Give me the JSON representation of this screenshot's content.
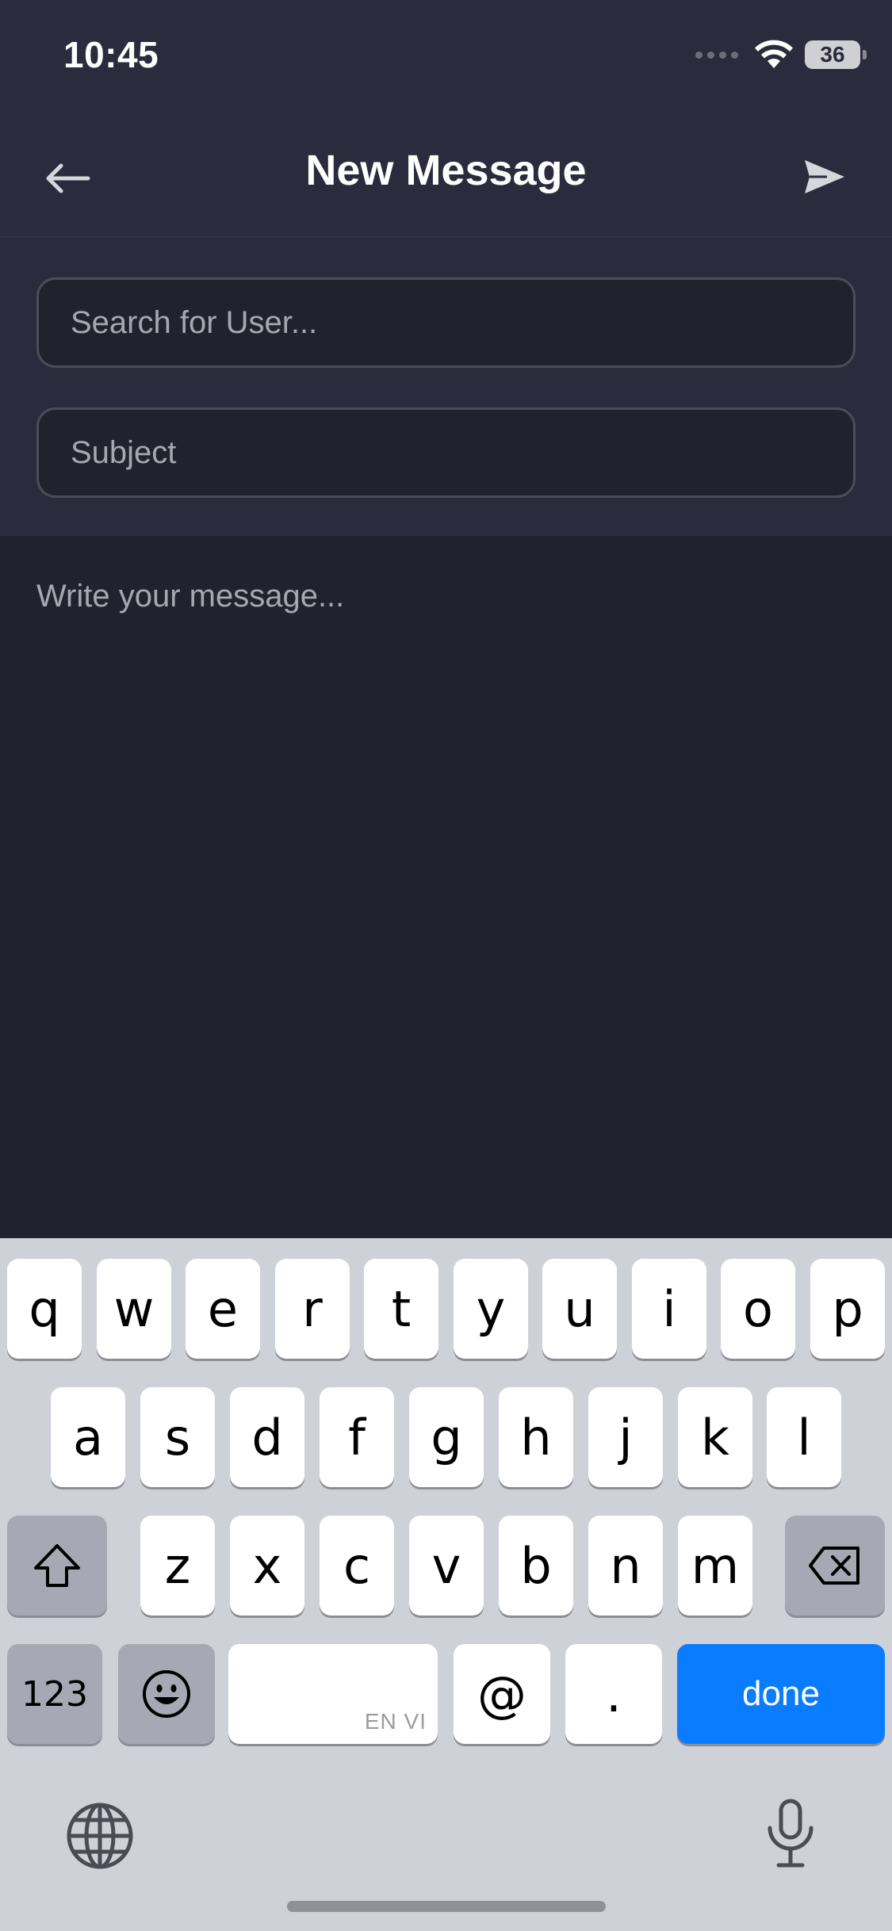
{
  "status_bar": {
    "time": "10:45",
    "battery_level": "36"
  },
  "nav": {
    "title": "New Message",
    "back_icon": "arrow-left-icon",
    "send_icon": "send-icon"
  },
  "form": {
    "user_placeholder": "Search for User...",
    "subject_placeholder": "Subject",
    "message_placeholder": "Write your message..."
  },
  "keyboard": {
    "row1": [
      "q",
      "w",
      "e",
      "r",
      "t",
      "y",
      "u",
      "i",
      "o",
      "p"
    ],
    "row2": [
      "a",
      "s",
      "d",
      "f",
      "g",
      "h",
      "j",
      "k",
      "l"
    ],
    "row3": [
      "z",
      "x",
      "c",
      "v",
      "b",
      "n",
      "m"
    ],
    "numbers_label": "123",
    "space_lang": "EN VI",
    "at_label": "@",
    "period_label": ".",
    "done_label": "done"
  },
  "colors": {
    "header_bg": "#2b2b3d",
    "body_bg": "#22222e",
    "accent_blue": "#0a7cff",
    "keyboard_bg": "#cfd1d8"
  }
}
